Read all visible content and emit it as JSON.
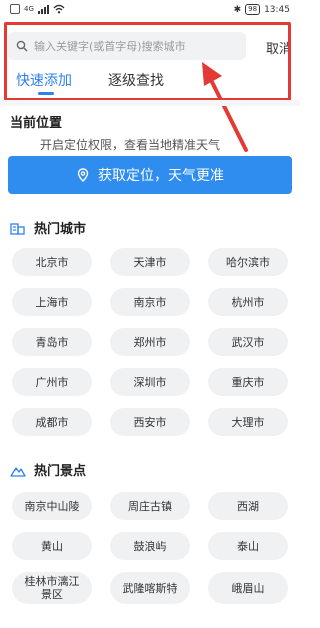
{
  "status_bar": {
    "time": "13:45",
    "battery": "98",
    "network": "4G"
  },
  "search": {
    "placeholder": "输入关键字(或首字母)搜索城市",
    "cancel_label": "取消"
  },
  "tabs": [
    {
      "label": "快速添加",
      "active": true
    },
    {
      "label": "逐级查找",
      "active": false
    }
  ],
  "current_location": {
    "title": "当前位置",
    "hint": "开启定位权限，查看当地精准天气",
    "button_label": "获取定位，天气更准"
  },
  "hot_cities": {
    "title": "热门城市",
    "items": [
      "北京市",
      "天津市",
      "哈尔滨市",
      "上海市",
      "南京市",
      "杭州市",
      "青岛市",
      "郑州市",
      "武汉市",
      "广州市",
      "深圳市",
      "重庆市",
      "成都市",
      "西安市",
      "大理市"
    ]
  },
  "hot_spots": {
    "title": "热门景点",
    "items": [
      "南京中山陵",
      "周庄古镇",
      "西湖",
      "黄山",
      "鼓浪屿",
      "泰山",
      "桂林市漓江景区",
      "武隆喀斯特",
      "峨眉山"
    ]
  },
  "colors": {
    "accent": "#2f80ed",
    "button": "#2f8df0",
    "annotation": "#e53935",
    "chip_bg": "#f0f1f3"
  },
  "icons": {
    "search": "search-icon",
    "location": "location-pin-icon",
    "city": "building-icon",
    "spot": "mountain-icon"
  }
}
